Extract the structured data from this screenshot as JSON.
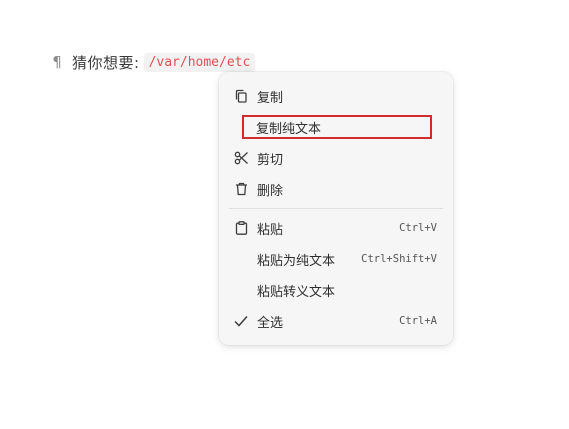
{
  "paragraph": {
    "pilcrow": "¶",
    "text": "猜你想要:",
    "code": "/var/home/etc"
  },
  "context_menu": {
    "items": [
      {
        "label": "复制",
        "icon": "copy-icon",
        "shortcut": ""
      },
      {
        "label": "复制纯文本",
        "icon": "",
        "shortcut": ""
      },
      {
        "label": "剪切",
        "icon": "scissors-icon",
        "shortcut": ""
      },
      {
        "label": "删除",
        "icon": "trash-icon",
        "shortcut": ""
      },
      {
        "label": "粘贴",
        "icon": "clipboard-icon",
        "shortcut": "Ctrl+V"
      },
      {
        "label": "粘贴为纯文本",
        "icon": "",
        "shortcut": "Ctrl+Shift+V"
      },
      {
        "label": "粘贴转义文本",
        "icon": "",
        "shortcut": ""
      },
      {
        "label": "全选",
        "icon": "check-icon",
        "shortcut": "Ctrl+A"
      }
    ]
  },
  "colors": {
    "code_text": "#e05252",
    "highlight_border": "#d22b2b",
    "menu_background": "#f6f6f6"
  }
}
